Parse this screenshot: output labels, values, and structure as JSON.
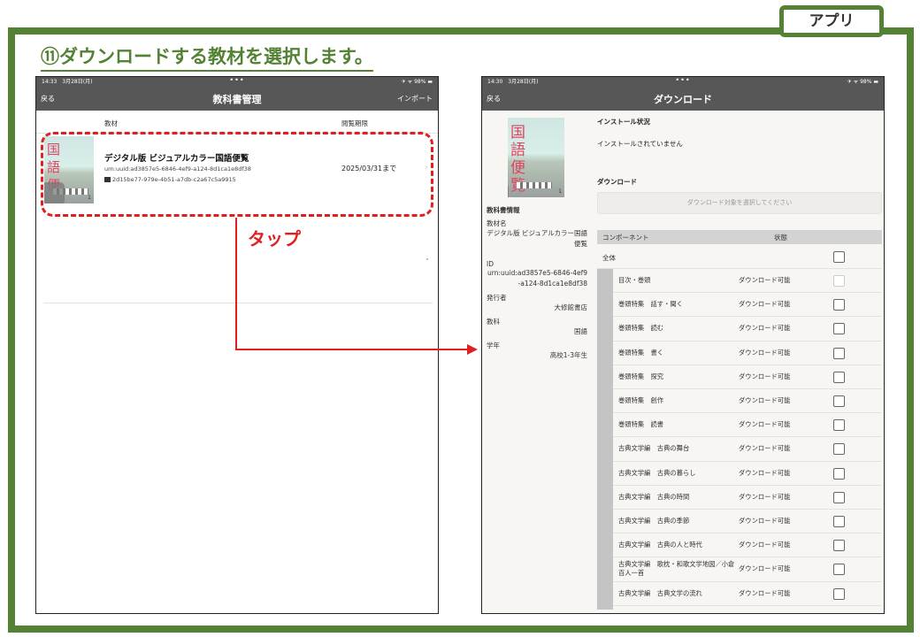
{
  "app_tab": "アプリ",
  "step_title": "⑪ダウンロードする教材を選択します。",
  "annotation": {
    "tap": "タップ"
  },
  "screen1": {
    "status_time": "14:33　3月28日(月)",
    "status_right": "✈ ᯤ 98% ▬",
    "nav_back": "戻る",
    "nav_title": "教科書管理",
    "nav_import": "インポート",
    "col_material": "教材",
    "col_expiry": "閲覧期限",
    "book": {
      "title": "デジタル版 ビジュアルカラー国語便覧",
      "urn": "urn:uuid:ad3857e5-6846-4ef9-a124-8d1ca1e8df38",
      "hash": "2d15be77-979e-4b51-a7db-c2a67c5a9915",
      "expiry": "2025/03/31まで",
      "cover_chars": [
        "国",
        "語",
        "便"
      ],
      "cover_num": "1"
    }
  },
  "screen2": {
    "status_time": "14:30　3月28日(月)",
    "status_right": "✈ ᯤ 98% ▬",
    "nav_back": "戻る",
    "nav_title": "ダウンロード",
    "cover_chars": [
      "国",
      "語",
      "便",
      "覧"
    ],
    "cover_num": "1",
    "install_status_label": "インストール状況",
    "install_status_value": "インストールされていません",
    "download_label": "ダウンロード",
    "download_placeholder": "ダウンロード対象を選択してください",
    "info": {
      "heading": "教科書情報",
      "name_label": "教材名",
      "name_value": "デジタル版 ビジュアルカラー国語便覧",
      "id_label": "ID",
      "id_value": "urn:uuid:ad3857e5-6846-4ef9-a124-8d1ca1e8df38",
      "publisher_label": "発行者",
      "publisher_value": "大修館書店",
      "subject_label": "教科",
      "subject_value": "国語",
      "grade_label": "学年",
      "grade_value": "高校1-3年生"
    },
    "table": {
      "col_component": "コンポーネント",
      "col_status": "状態",
      "all_label": "全体",
      "rows": [
        {
          "name": "目次・巻頭",
          "status": "ダウンロード可能",
          "disabled": true
        },
        {
          "name": "巻頭特集　話す・聞く",
          "status": "ダウンロード可能"
        },
        {
          "name": "巻頭特集　読む",
          "status": "ダウンロード可能"
        },
        {
          "name": "巻頭特集　書く",
          "status": "ダウンロード可能"
        },
        {
          "name": "巻頭特集　探究",
          "status": "ダウンロード可能"
        },
        {
          "name": "巻頭特集　創作",
          "status": "ダウンロード可能"
        },
        {
          "name": "巻頭特集　読書",
          "status": "ダウンロード可能"
        },
        {
          "name": "古典文学編　古典の舞台",
          "status": "ダウンロード可能"
        },
        {
          "name": "古典文学編　古典の暮らし",
          "status": "ダウンロード可能"
        },
        {
          "name": "古典文学編　古典の時間",
          "status": "ダウンロード可能"
        },
        {
          "name": "古典文学編　古典の季節",
          "status": "ダウンロード可能"
        },
        {
          "name": "古典文学編　古典の人と時代",
          "status": "ダウンロード可能"
        },
        {
          "name": "古典文学編　歌枕・和歌文学地図／小倉百人一首",
          "status": "ダウンロード可能"
        },
        {
          "name": "古典文学編　古典文学の流れ",
          "status": "ダウンロード可能"
        }
      ]
    }
  }
}
